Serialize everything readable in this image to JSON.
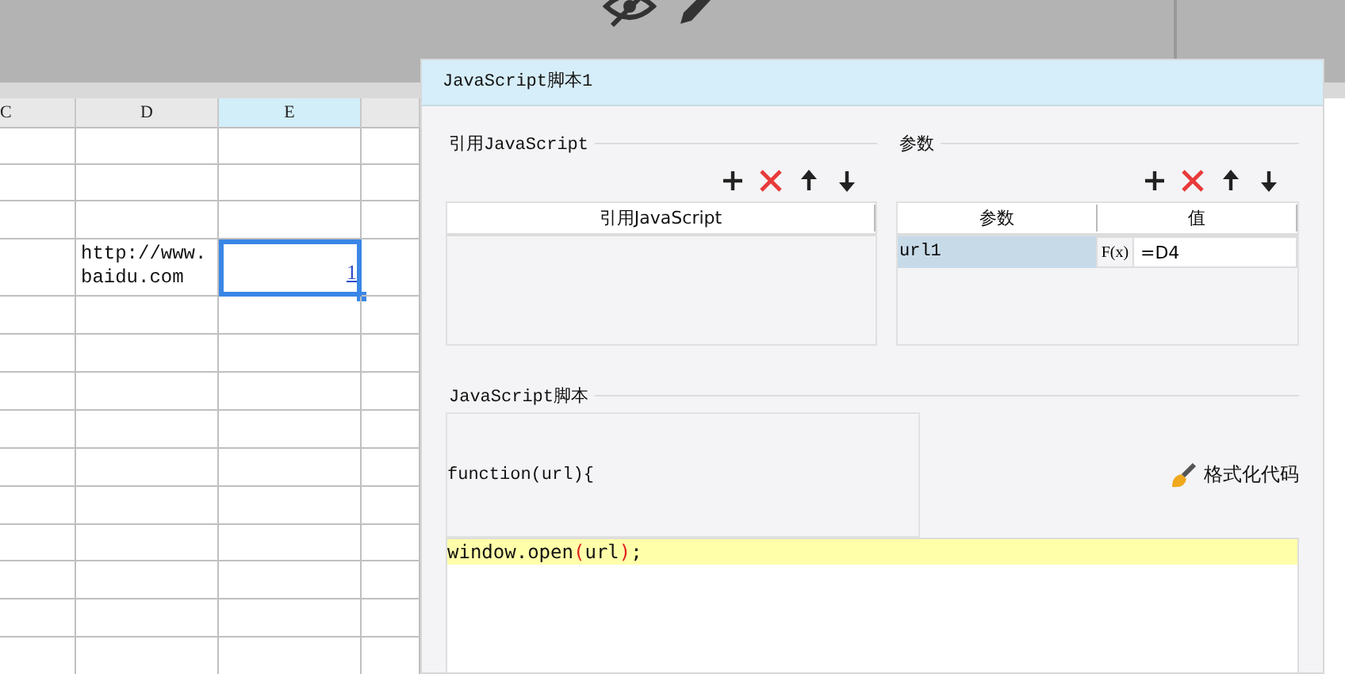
{
  "toolbar": {
    "tools": [
      {
        "kind": "hide"
      },
      {
        "kind": "edit"
      }
    ]
  },
  "sheet": {
    "columns": [
      {
        "label": "C",
        "selected": false
      },
      {
        "label": "D",
        "selected": false
      },
      {
        "label": "E",
        "selected": true
      }
    ],
    "content_row": {
      "cells": [
        {
          "kind": "empty"
        },
        {
          "kind": "text",
          "text": "http://www.baidu.com"
        },
        {
          "kind": "link",
          "text": "1",
          "selected": true
        }
      ]
    }
  },
  "dialog": {
    "title": "JavaScript脚本1",
    "references": {
      "label": "引用JavaScript",
      "columns": [
        "引用JavaScript"
      ]
    },
    "parameters": {
      "label": "参数",
      "columns": [
        "参数",
        "值"
      ],
      "rows": [
        {
          "name": "url1",
          "formula_button": "F(x)",
          "value": "=D4",
          "selected": true
        }
      ]
    },
    "script": {
      "label": "JavaScript脚本",
      "header": "function(url){",
      "format_button": "格式化代码",
      "lines": [
        {
          "text": "window.open(url);",
          "current": true
        }
      ]
    }
  }
}
